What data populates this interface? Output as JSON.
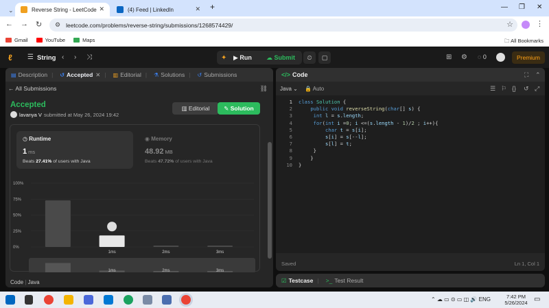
{
  "browser": {
    "tabs": [
      {
        "title": "Reverse String - LeetCode",
        "active": true
      },
      {
        "title": "(4) Feed | LinkedIn",
        "active": false
      }
    ],
    "url": "leetcode.com/problems/reverse-string/submissions/1268574429/",
    "bookmarks": [
      "Gmail",
      "YouTube",
      "Maps"
    ],
    "all_bookmarks": "All Bookmarks"
  },
  "header": {
    "problem_list": "String",
    "run": "Run",
    "submit": "Submit",
    "streak": "0",
    "premium": "Premium"
  },
  "left": {
    "tabs": [
      "Description",
      "Accepted",
      "Editorial",
      "Solutions",
      "Submissions"
    ],
    "all_submissions": "All Submissions",
    "status": "Accepted",
    "user": "lavanya V",
    "submitted_text": "submitted at May 26, 2024 19:42",
    "editorial_btn": "Editorial",
    "solution_btn": "Solution",
    "runtime": {
      "label": "Runtime",
      "value": "1",
      "unit": "ms",
      "beats_pre": "Beats",
      "beats": "27.41%",
      "beats_post": "of users with Java"
    },
    "memory": {
      "label": "Memory",
      "value": "48.92",
      "unit": "MB",
      "beats_pre": "Beats",
      "beats": "47.72%",
      "beats_post": "of users with Java"
    },
    "footer": {
      "code": "Code",
      "lang": "Java"
    }
  },
  "chart_data": {
    "type": "bar",
    "categories": [
      "",
      "1ms",
      "2ms",
      "3ms"
    ],
    "values": [
      73,
      18,
      1,
      1
    ],
    "highlight_category": "1ms",
    "y_ticks": [
      "100%",
      "75%",
      "50%",
      "25%",
      "0%"
    ],
    "ylim": [
      0,
      100
    ],
    "overview_labels": [
      "1ms",
      "2ms",
      "3ms"
    ]
  },
  "code_panel": {
    "title": "Code",
    "language": "Java",
    "mode": "Auto",
    "lines": [
      "class Solution {",
      "    public void reverseString(char[] s) {",
      "     int l = s.length;",
      "     for(int i =0; i <=(s.length - 1)/2 ; i++){",
      "         char t = s[i];",
      "         s[i] = s[--l];",
      "         s[l] = t;",
      "     }",
      "    }",
      "}"
    ],
    "saved": "Saved",
    "cursor": "Ln 1, Col 1"
  },
  "testbar": {
    "testcase": "Testcase",
    "result": "Test Result"
  },
  "taskbar": {
    "lang": "ENG",
    "time": "7:42 PM",
    "date": "5/26/2024"
  }
}
